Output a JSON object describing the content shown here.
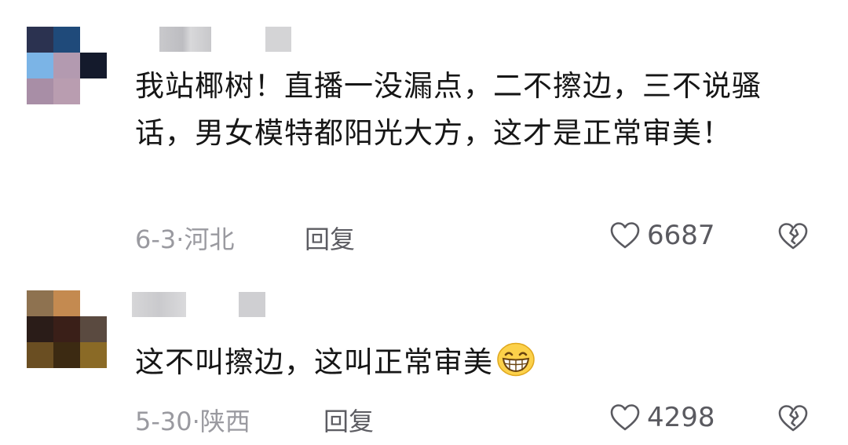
{
  "comments": [
    {
      "text": "我站椰树！直播一没漏点，二不擦边，三不说骚话，男女模特都阳光大方，这才是正常审美！",
      "date": "6-3",
      "separator": "·",
      "region": "河北",
      "reply_label": "回复",
      "likes": "6687",
      "avatar_colors": [
        "#2b3250",
        "#1f4a7a",
        "#ffffff",
        "#7bb4e6",
        "#b39ab0",
        "#141a2c",
        "#a88ea6",
        "#b99db0",
        "#ffffff"
      ]
    },
    {
      "text": "这不叫擦边，这叫正常审美",
      "emoji": "grinning-face-emoji",
      "date": "5-30",
      "separator": "·",
      "region": "陕西",
      "reply_label": "回复",
      "likes": "4298",
      "avatar_colors": [
        "#8e7250",
        "#c48a50",
        "#ffffff",
        "#2a1c18",
        "#3a1f18",
        "#5a4a40",
        "#6a4e22",
        "#3c2a12",
        "#8a6a26"
      ]
    }
  ],
  "icons": {
    "like": "heart-outline-icon",
    "dislike": "broken-heart-icon"
  },
  "colors": {
    "meta_text": "#9a9aa0",
    "reply_text": "#5c5c62",
    "body_text": "#161616"
  }
}
